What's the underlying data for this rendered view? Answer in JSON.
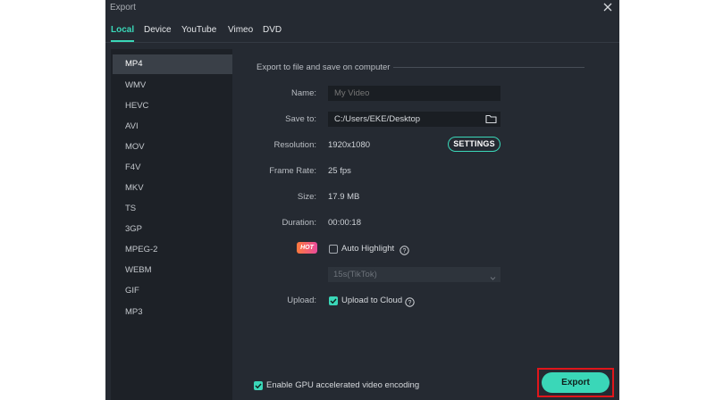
{
  "window": {
    "title": "Export"
  },
  "tabs": [
    {
      "label": "Local",
      "active": true
    },
    {
      "label": "Device",
      "active": false
    },
    {
      "label": "YouTube",
      "active": false
    },
    {
      "label": "Vimeo",
      "active": false
    },
    {
      "label": "DVD",
      "active": false
    }
  ],
  "formats": [
    "MP4",
    "WMV",
    "HEVC",
    "AVI",
    "MOV",
    "F4V",
    "MKV",
    "TS",
    "3GP",
    "MPEG-2",
    "WEBM",
    "GIF",
    "MP3"
  ],
  "selected_format": "MP4",
  "main": {
    "section_title": "Export to file and save on computer",
    "name_label": "Name:",
    "name_placeholder": "My Video",
    "save_to_label": "Save to:",
    "save_to_value": "C:/Users/EKE/Desktop",
    "resolution_label": "Resolution:",
    "resolution_value": "1920x1080",
    "settings_label": "SETTINGS",
    "frame_rate_label": "Frame Rate:",
    "frame_rate_value": "25 fps",
    "size_label": "Size:",
    "size_value": "17.9 MB",
    "duration_label": "Duration:",
    "duration_value": "00:00:18",
    "hot_badge": "HOT",
    "auto_highlight_label": "Auto Highlight",
    "auto_highlight_checked": false,
    "highlight_option": "15s(TikTok)",
    "upload_label": "Upload:",
    "upload_cloud_label": "Upload to Cloud",
    "upload_cloud_checked": true
  },
  "footer": {
    "gpu_label": "Enable GPU accelerated video encoding",
    "gpu_checked": true,
    "export_label": "Export"
  },
  "colors": {
    "accent": "#3ad7b8",
    "window_bg": "#252a32",
    "sidebar_bg": "#1d2127",
    "highlight_frame": "#e0161b"
  }
}
